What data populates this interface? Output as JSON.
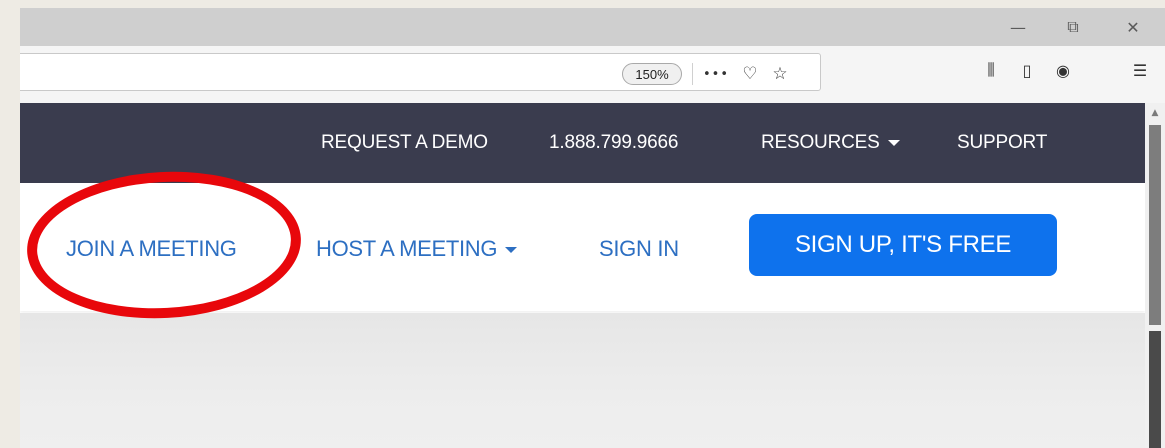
{
  "browser": {
    "window_controls": {
      "minimize_glyph": "—",
      "restore_glyph": "⧉",
      "close_glyph": "✕"
    },
    "urlbar": {
      "zoom_level": "150%",
      "page_actions_glyph": "•••",
      "pocket_glyph": "♡",
      "bookmark_glyph": "☆"
    },
    "toolbar_icons": {
      "library_glyph": "⫼",
      "sidebar_glyph": "▯",
      "account_glyph": "◉",
      "menu_glyph": "☰"
    }
  },
  "site": {
    "top_nav": {
      "request_demo": "REQUEST A DEMO",
      "phone": "1.888.799.9666",
      "resources": "RESOURCES",
      "support": "SUPPORT"
    },
    "main_nav": {
      "join_meeting": "JOIN A MEETING",
      "host_meeting": "HOST A MEETING",
      "sign_in": "SIGN IN",
      "sign_up": "SIGN UP, IT'S FREE"
    }
  },
  "colors": {
    "top_nav_bg": "#3a3c4e",
    "link_blue": "#2d6fc2",
    "button_blue": "#0e72ed",
    "annotation_red": "#e8070b"
  }
}
